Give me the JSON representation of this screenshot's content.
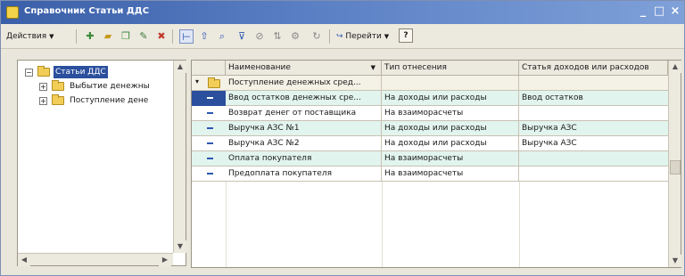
{
  "window": {
    "title": "Справочник Статьи ДДС",
    "minimize_glyph": "_",
    "maximize_glyph": "□",
    "close_glyph": "×"
  },
  "toolbar": {
    "actions_label": "Действия",
    "goto_label": "Перейти",
    "help_label": "?",
    "icons": [
      "add-icon",
      "add-folder-icon",
      "copy-icon",
      "edit-icon",
      "delete-icon",
      "hierarchy-icon",
      "up-level-icon",
      "find-icon",
      "filter-icon",
      "filter-off-icon",
      "sort-icon",
      "settings-icon",
      "refresh-icon"
    ]
  },
  "tree": {
    "root_label": "Статьи ДДС",
    "root_expander": "⊟",
    "items": [
      {
        "label": "Выбытие денежны",
        "expander": "⊞"
      },
      {
        "label": "Поступление дене",
        "expander": "⊞"
      }
    ]
  },
  "table": {
    "columns": [
      "Наименование",
      "Тип отнесения",
      "Статья доходов или расходов"
    ],
    "rows": [
      {
        "name": "Поступление денежных сред...",
        "type": "",
        "article": "",
        "kind": "group"
      },
      {
        "name": "Ввод остатков денежных сре...",
        "type": "На доходы или расходы",
        "article": "Ввод остатков",
        "kind": "selected"
      },
      {
        "name": "Возврат денег от поставщика",
        "type": "На взаиморасчеты",
        "article": "",
        "kind": "item"
      },
      {
        "name": "Выручка АЗС №1",
        "type": "На доходы или расходы",
        "article": "Выручка АЗС",
        "kind": "item"
      },
      {
        "name": "Выручка АЗС №2",
        "type": "На доходы или расходы",
        "article": "Выручка АЗС",
        "kind": "item"
      },
      {
        "name": "Оплата покупателя",
        "type": "На взаиморасчеты",
        "article": "",
        "kind": "item"
      },
      {
        "name": "Предоплата покупателя",
        "type": "На взаиморасчеты",
        "article": "",
        "kind": "item"
      }
    ]
  },
  "colors": {
    "titlebar": "#3a5fa8",
    "selection": "#2b4f9d",
    "row_tint": "#e2f4ee",
    "window_bg": "#e9e6dc"
  }
}
